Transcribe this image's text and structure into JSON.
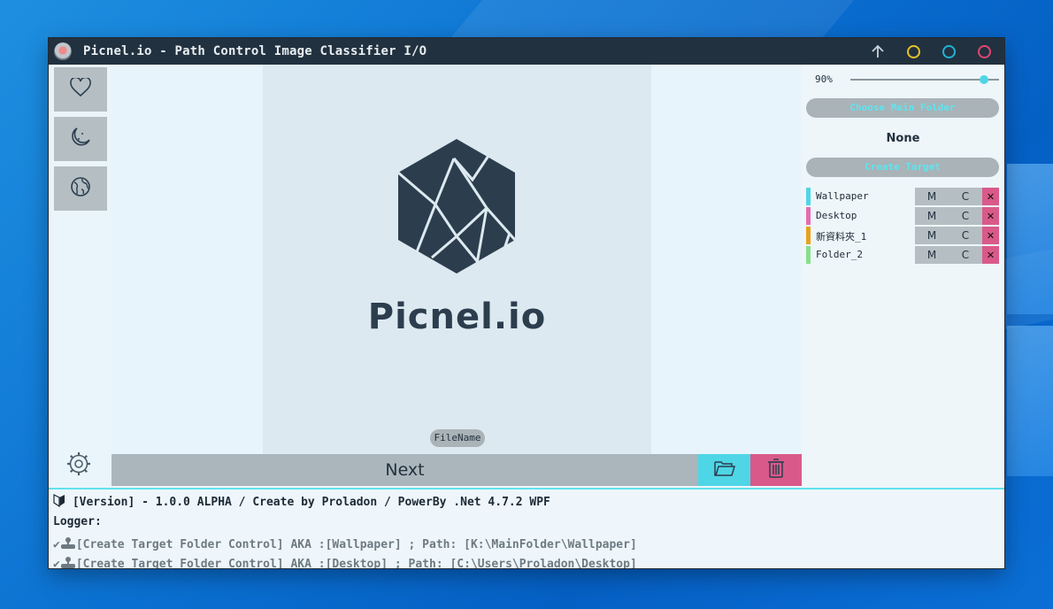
{
  "window": {
    "title": "Picnel.io - Path Control Image Classifier I/O",
    "controls": [
      {
        "name": "top-button",
        "color": "#c9d3da"
      },
      {
        "name": "minimize-button",
        "color": "#e6c229"
      },
      {
        "name": "maximize-button",
        "color": "#1fb3d6"
      },
      {
        "name": "close-button",
        "color": "#e0476f"
      }
    ]
  },
  "sidebar": {
    "items": [
      {
        "icon": "heart-icon"
      },
      {
        "icon": "moon-icon"
      },
      {
        "icon": "globe-icon"
      }
    ],
    "settings_icon": "gear-icon"
  },
  "preview": {
    "logo_text": "Picnel.io",
    "filename_label": "FileName"
  },
  "actions": {
    "next_label": "Next",
    "folder_icon": "folder-icon",
    "trash_icon": "trash-icon"
  },
  "right_panel": {
    "zoom_label": "90%",
    "zoom_value": 0.9,
    "choose_folder_label": "Choose Main Folder",
    "main_folder_value": "None",
    "create_target_label": "Create Target",
    "targets": [
      {
        "name": "Wallpaper",
        "color": "#4fd6e6",
        "m": "M",
        "c": "C",
        "x": "✕"
      },
      {
        "name": "Desktop",
        "color": "#e56cb0",
        "m": "M",
        "c": "C",
        "x": "✕"
      },
      {
        "name": "新資料夾_1",
        "color": "#e8a21a",
        "m": "M",
        "c": "C",
        "x": "✕"
      },
      {
        "name": "Folder_2",
        "color": "#86e08a",
        "m": "M",
        "c": "C",
        "x": "✕"
      }
    ]
  },
  "log": {
    "version_line": "[Version] - 1.0.0 ALPHA / Create by Proladon / PowerBy .Net 4.7.2 WPF",
    "logger_label": "Logger:",
    "entries": [
      "[Create Target Folder Control] AKA :[Wallpaper] ; Path: [K:\\MainFolder\\Wallpaper]",
      "[Create Target Folder Control] AKA :[Desktop] ; Path: [C:\\Users\\Proladon\\Desktop]"
    ]
  },
  "colors": {
    "accent": "#4fd6e6",
    "danger": "#d95a8a",
    "titlebar": "#22313f"
  }
}
